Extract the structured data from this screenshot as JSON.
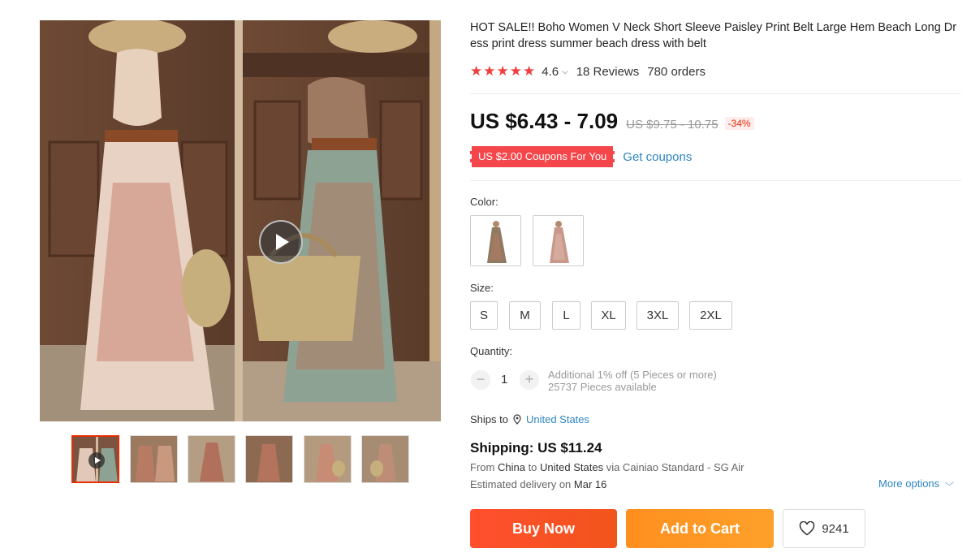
{
  "gallery": {
    "thumbnail_count": 6,
    "active_thumbnail": 0,
    "has_video": true
  },
  "product": {
    "title": "HOT SALE!! Boho Women V Neck Short Sleeve Paisley Print Belt Large Hem Beach Long Dress print dress summer beach dress with belt",
    "rating": "4.6",
    "stars": 5,
    "reviews": "18 Reviews",
    "orders": "780 orders",
    "price": "US $6.43 - 7.09",
    "original_price": "US $9.75 - 10.75",
    "discount": "-34%",
    "coupon_label": "US $2.00 Coupons For You",
    "get_coupons": "Get coupons"
  },
  "options": {
    "color_label": "Color:",
    "size_label": "Size:",
    "sizes": [
      "S",
      "M",
      "L",
      "XL",
      "3XL",
      "2XL"
    ],
    "quantity_label": "Quantity:",
    "quantity": "1",
    "qty_minus": "−",
    "qty_plus": "+",
    "bulk_note": "Additional 1% off (5 Pieces or more)",
    "available": "25737 Pieces available"
  },
  "shipping": {
    "ships_to_label": "Ships to",
    "ships_to_country": "United States",
    "title": "Shipping: US $11.24",
    "from_prefix": "From",
    "from_country": "China",
    "to_word": "to",
    "to_country": "United States",
    "via_text": "via Cainiao Standard - SG Air",
    "delivery_prefix": "Estimated delivery on",
    "delivery_date": "Mar 16",
    "more_options": "More options"
  },
  "actions": {
    "buy_now": "Buy Now",
    "add_to_cart": "Add to Cart",
    "wishlist_count": "9241"
  },
  "colors": {
    "star": "#f03e3e",
    "link": "#2e86c1",
    "buy_now": "#f2541c",
    "add_to_cart": "#fd9a26",
    "coupon": "#f5474b",
    "active_thumb_border": "#e62e04"
  },
  "icons": {
    "play": "play-icon",
    "pin": "location-pin-icon",
    "heart": "heart-icon",
    "chevron": "chevron-down-icon"
  }
}
